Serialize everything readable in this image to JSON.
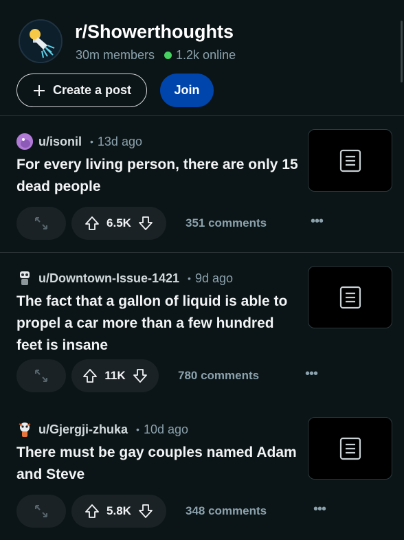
{
  "subreddit": {
    "name": "r/Showerthoughts",
    "members": "30m members",
    "online": "1.2k online",
    "create_post_label": "Create a post",
    "join_label": "Join",
    "colors": {
      "online": "#46d160",
      "join": "#0045ac",
      "background": "#0b1416"
    }
  },
  "posts": [
    {
      "username": "u/isonil",
      "age": "13d ago",
      "title": "For every living person, there are only 15 dead people",
      "votes": "6.5K",
      "comments": "351 comments",
      "avatar_icon": "purple-snoo-avatar-icon"
    },
    {
      "username": "u/Downtown-Issue-1421",
      "age": "9d ago",
      "title": "The fact that a gallon of liquid is able to propel a car more than a few hundred feet is insane",
      "votes": "11K",
      "comments": "780 comments",
      "avatar_icon": "robot-snoo-avatar-icon"
    },
    {
      "username": "u/Gjergji-zhuka",
      "age": "10d ago",
      "title": "There must be gay couples named Adam and Steve",
      "votes": "5.8K",
      "comments": "348 comments",
      "avatar_icon": "monkey-snoo-avatar-icon"
    }
  ],
  "icons": {
    "subreddit": "shower-lightbulb-icon",
    "create": "plus-icon",
    "expand": "expand-arrows-icon",
    "upvote": "upvote-arrow-icon",
    "downvote": "downvote-arrow-icon",
    "more": "more-options-icon",
    "thumbnail": "text-post-icon"
  }
}
